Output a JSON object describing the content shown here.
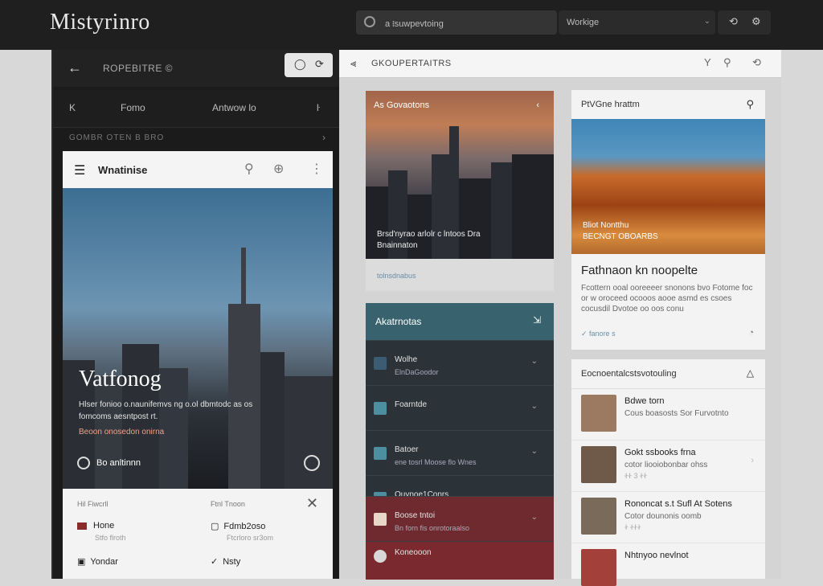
{
  "app": {
    "logo": "Mistyrinro"
  },
  "topbar": {
    "search_text": "a ᎒suwpevtoing",
    "select_value": "Workige",
    "icon_names": [
      "refresh-icon",
      "settings-icon"
    ]
  },
  "left": {
    "header_title": "ROPEBITRE ©",
    "nav": {
      "back": "K",
      "item1": "Fomo",
      "item2": "Antwow lo",
      "item3": "ŀ"
    },
    "breadcrumb": "GOMBR OTEN B BRO",
    "card": {
      "title": "Wnatinise",
      "hero": {
        "title": "Vatfonog",
        "text": "Hlser fonioo o.naunifemvs ng o.ol dbmtodc as os fomcoms aesntpost rt.",
        "link": "Beoon onosedon onirna",
        "foot": "Bo anltinnn"
      },
      "list": {
        "header_left": "Hil Fiwcrll",
        "header_right": "Ftnl Tnoon",
        "items": [
          {
            "label": "Hone",
            "sub": "Stfo flroth"
          },
          {
            "label": "Fdmb2oso",
            "sub": "Ftcrloro sr3om"
          },
          {
            "label": "Yondar",
            "sub": ""
          },
          {
            "label": "Nsty",
            "sub": ""
          }
        ]
      }
    }
  },
  "right": {
    "header_title": "GKOUPERTAITRS",
    "city_card": {
      "title": "As Govaotons",
      "caption_l1": "Brsd'nyrao arlolr c lntoos Dra",
      "caption_l2": "Bnainnaton",
      "footer": "tolnsdnabus"
    },
    "alert_card": {
      "title": "Akatrnotas",
      "items": [
        {
          "title": "Wolhe",
          "sub": "ElnDaGoodor"
        },
        {
          "title": "Foarntde",
          "sub": ""
        },
        {
          "title": "Batoer",
          "sub": "ene tosrl Moose flo Wnes"
        },
        {
          "title": "Quynoe1Conrs",
          "sub": ""
        },
        {
          "title": "Boose tntoi",
          "sub": "Bn forn fis onrotoraalso"
        },
        {
          "title": "Koneooon",
          "sub": ""
        }
      ]
    },
    "canyon_card": {
      "header": "PtVGne hrattm",
      "cap_l1": "Bliot Nontthu",
      "cap_l2": "BECNGT OBOARBS",
      "title": "Fathnaon kn noopelte",
      "text": "Fcottern ooal ooreeeer snonons bvo Fotome foc or w oroceed ocooos aooe asmd es csoes cocusdil Dvotoe oo oos conu",
      "meta": "fanore s"
    },
    "contacts": {
      "title": "Eocnoentalcstsvotouling",
      "items": [
        {
          "name": "Bdwe torn",
          "sub": "Cous boasosts Sor Furvotnto",
          "sub2": ""
        },
        {
          "name": "Gokt ssbooks frna",
          "sub": "cotor liooiobonbar ohss",
          "sub2": "ᏐᏐ 3 ᏐᏐ"
        },
        {
          "name": "Rononcat s.t Sufl At Sotens",
          "sub": "Cotor dounonis oomb",
          "sub2": "Ꮠ ᏐᏐᏐ"
        },
        {
          "name": "Nhtnyoo nevlnot",
          "sub": "",
          "sub2": ""
        }
      ]
    }
  },
  "colors": {
    "topbar": "#1f1f1f",
    "accent_teal": "#38636e",
    "link_blue": "#6a8da8",
    "alert_red": "#7a2a2a"
  }
}
